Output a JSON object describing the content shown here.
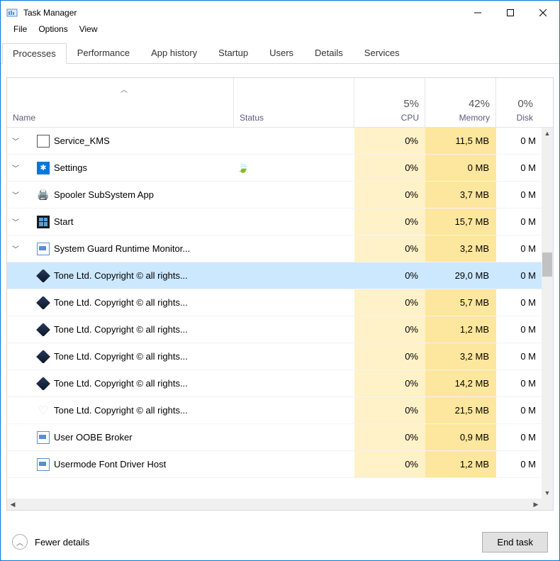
{
  "window": {
    "title": "Task Manager"
  },
  "menubar": {
    "file": "File",
    "options": "Options",
    "view": "View"
  },
  "tabs": {
    "processes": "Processes",
    "performance": "Performance",
    "app_history": "App history",
    "startup": "Startup",
    "users": "Users",
    "details": "Details",
    "services": "Services"
  },
  "columns": {
    "name": "Name",
    "status": "Status",
    "cpu_pct": "5%",
    "cpu": "CPU",
    "mem_pct": "42%",
    "memory": "Memory",
    "disk_pct": "0%",
    "disk": "Disk"
  },
  "rows": [
    {
      "expand": true,
      "icon": "kms",
      "name": "Service_KMS",
      "status": "",
      "cpu": "0%",
      "mem": "11,5 MB",
      "disk": "0 M"
    },
    {
      "expand": true,
      "icon": "settings",
      "name": "Settings",
      "status": "leaf",
      "cpu": "0%",
      "mem": "0 MB",
      "disk": "0 M"
    },
    {
      "expand": true,
      "icon": "spooler",
      "name": "Spooler SubSystem App",
      "status": "",
      "cpu": "0%",
      "mem": "3,7 MB",
      "disk": "0 M"
    },
    {
      "expand": true,
      "icon": "start",
      "name": "Start",
      "status": "",
      "cpu": "0%",
      "mem": "15,7 MB",
      "disk": "0 M"
    },
    {
      "expand": true,
      "icon": "guard",
      "name": "System Guard Runtime Monitor...",
      "status": "",
      "cpu": "0%",
      "mem": "3,2 MB",
      "disk": "0 M"
    },
    {
      "expand": false,
      "icon": "tone",
      "name": "Tone Ltd. Copyright © all rights...",
      "status": "",
      "cpu": "0%",
      "mem": "29,0 MB",
      "disk": "0 M",
      "selected": true
    },
    {
      "expand": false,
      "icon": "tone",
      "name": "Tone Ltd. Copyright © all rights...",
      "status": "",
      "cpu": "0%",
      "mem": "5,7 MB",
      "disk": "0 M"
    },
    {
      "expand": false,
      "icon": "tone",
      "name": "Tone Ltd. Copyright © all rights...",
      "status": "",
      "cpu": "0%",
      "mem": "1,2 MB",
      "disk": "0 M"
    },
    {
      "expand": false,
      "icon": "tone",
      "name": "Tone Ltd. Copyright © all rights...",
      "status": "",
      "cpu": "0%",
      "mem": "3,2 MB",
      "disk": "0 M"
    },
    {
      "expand": false,
      "icon": "tone",
      "name": "Tone Ltd. Copyright © all rights...",
      "status": "",
      "cpu": "0%",
      "mem": "14,2 MB",
      "disk": "0 M"
    },
    {
      "expand": false,
      "icon": "heart",
      "name": "Tone Ltd. Copyright © all rights...",
      "status": "",
      "cpu": "0%",
      "mem": "21,5 MB",
      "disk": "0 M"
    },
    {
      "expand": false,
      "icon": "oobe",
      "name": "User OOBE Broker",
      "status": "",
      "cpu": "0%",
      "mem": "0,9 MB",
      "disk": "0 M"
    },
    {
      "expand": false,
      "icon": "font",
      "name": "Usermode Font Driver Host",
      "status": "",
      "cpu": "0%",
      "mem": "1,2 MB",
      "disk": "0 M"
    }
  ],
  "footer": {
    "fewer_details": "Fewer details",
    "end_task": "End task"
  }
}
